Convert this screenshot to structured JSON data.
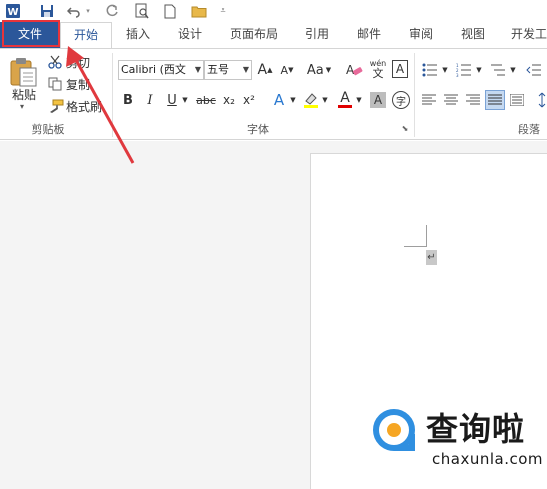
{
  "quick_access": {
    "word_icon": "word-app-icon",
    "save_icon": "save-icon",
    "undo_icon": "undo-icon",
    "redo_icon": "redo-icon",
    "print_preview_icon": "print-preview-icon",
    "new_icon": "new-document-icon",
    "open_icon": "open-folder-icon",
    "customize_icon": "customize-qat-icon"
  },
  "tabs": [
    {
      "label": "文件"
    },
    {
      "label": "开始"
    },
    {
      "label": "插入"
    },
    {
      "label": "设计"
    },
    {
      "label": "页面布局"
    },
    {
      "label": "引用"
    },
    {
      "label": "邮件"
    },
    {
      "label": "审阅"
    },
    {
      "label": "视图"
    },
    {
      "label": "开发工"
    }
  ],
  "clipboard": {
    "paste_label": "粘贴",
    "cut_label": "剪切",
    "copy_label": "复制",
    "format_painter_label": "格式刷",
    "group_label": "剪贴板"
  },
  "font": {
    "font_name": "Calibri (西文",
    "font_size": "五号",
    "grow_label": "A",
    "shrink_label": "A",
    "change_case_label": "Aa",
    "phonetic_top": "wén",
    "phonetic_bottom": "文",
    "char_border_label": "A",
    "bold_label": "B",
    "italic_label": "I",
    "underline_label": "U",
    "strike_label": "abc",
    "subscript_label": "x₂",
    "superscript_label": "x²",
    "text_effects_label": "A",
    "font_color_label": "A",
    "char_shading_label": "A",
    "enclose_label": "字",
    "group_label": "字体"
  },
  "paragraph": {
    "group_label": "段落"
  },
  "document": {
    "paragraph_mark": "↵"
  },
  "watermark": {
    "text": "查询啦",
    "url": "chaxunla.com"
  },
  "colors": {
    "file_tab": "#2b579a",
    "highlight_box": "#e8343b",
    "arrow": "#e0393e",
    "font_color_bar": "#e00000",
    "highlight_bar": "#ffff00"
  }
}
